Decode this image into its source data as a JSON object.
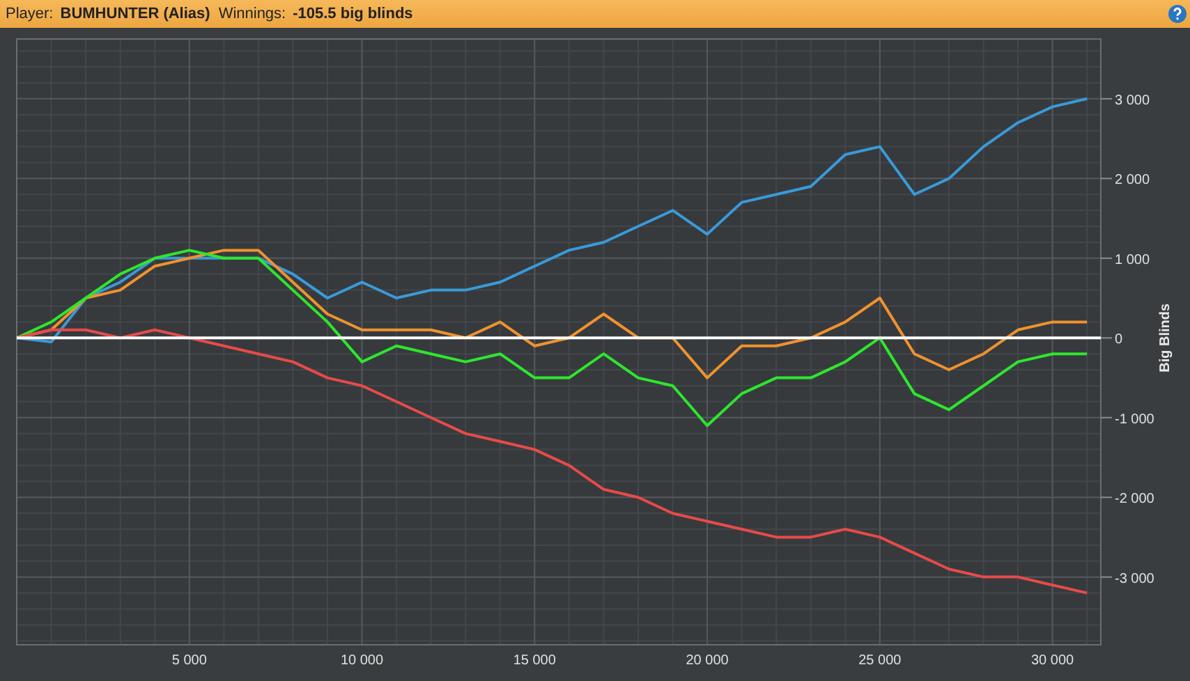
{
  "header": {
    "player_label": "Player:",
    "player": "BUMHUNTER (Alias)",
    "winnings_label": "Winnings:",
    "winnings": "-105.5 big blinds"
  },
  "chart": {
    "chart_data": {
      "type": "line",
      "grid": true,
      "ylabel": "Big Blinds",
      "x": [
        0,
        1000,
        2000,
        3000,
        4000,
        5000,
        6000,
        7000,
        8000,
        9000,
        10000,
        11000,
        12000,
        13000,
        14000,
        15000,
        16000,
        17000,
        18000,
        19000,
        20000,
        21000,
        22000,
        23000,
        24000,
        25000,
        26000,
        27000,
        28000,
        29000,
        30000,
        31000
      ],
      "series": [
        {
          "color": "#3a9ad9",
          "values": [
            0,
            -50,
            500,
            700,
            1000,
            1000,
            1000,
            1000,
            800,
            500,
            700,
            500,
            600,
            600,
            700,
            900,
            1100,
            1200,
            1400,
            1600,
            1300,
            1700,
            1800,
            1900,
            2300,
            2400,
            1800,
            2000,
            2400,
            2700,
            2900,
            3000
          ]
        },
        {
          "color": "#f0922e",
          "values": [
            0,
            100,
            500,
            600,
            900,
            1000,
            1100,
            1100,
            700,
            300,
            100,
            100,
            100,
            0,
            200,
            -100,
            0,
            300,
            0,
            0,
            -500,
            -100,
            -100,
            0,
            200,
            500,
            -200,
            -400,
            -200,
            100,
            200,
            200
          ]
        },
        {
          "color": "#2ee62e",
          "values": [
            0,
            200,
            500,
            800,
            1000,
            1100,
            1000,
            1000,
            600,
            200,
            -300,
            -100,
            -200,
            -300,
            -200,
            -500,
            -500,
            -200,
            -500,
            -600,
            -1100,
            -700,
            -500,
            -500,
            -300,
            0,
            -700,
            -900,
            -600,
            -300,
            -200,
            -200
          ]
        },
        {
          "color": "#e84a4a",
          "values": [
            0,
            100,
            100,
            0,
            100,
            0,
            -100,
            -200,
            -300,
            -500,
            -600,
            -800,
            -1000,
            -1200,
            -1300,
            -1400,
            -1600,
            -1900,
            -2000,
            -2200,
            -2300,
            -2400,
            -2500,
            -2500,
            -2400,
            -2500,
            -2700,
            -2900,
            -3000,
            -3000,
            -3100,
            -3200
          ]
        }
      ],
      "xlim": [
        0,
        31400
      ],
      "ylim": [
        -3850,
        3750
      ],
      "xticks": [
        {
          "value": 5000,
          "label": "5 000"
        },
        {
          "value": 10000,
          "label": "10 000"
        },
        {
          "value": 15000,
          "label": "15 000"
        },
        {
          "value": 20000,
          "label": "20 000"
        },
        {
          "value": 25000,
          "label": "25 000"
        },
        {
          "value": 30000,
          "label": "30 000"
        }
      ],
      "yticks": [
        {
          "value": 3000,
          "label": "3 000"
        },
        {
          "value": 2000,
          "label": "2 000"
        },
        {
          "value": 1000,
          "label": "1 000"
        },
        {
          "value": 0,
          "label": "0"
        },
        {
          "value": -1000,
          "label": "-1 000"
        },
        {
          "value": -2000,
          "label": "-2 000"
        },
        {
          "value": -3000,
          "label": "-3 000"
        }
      ]
    }
  }
}
